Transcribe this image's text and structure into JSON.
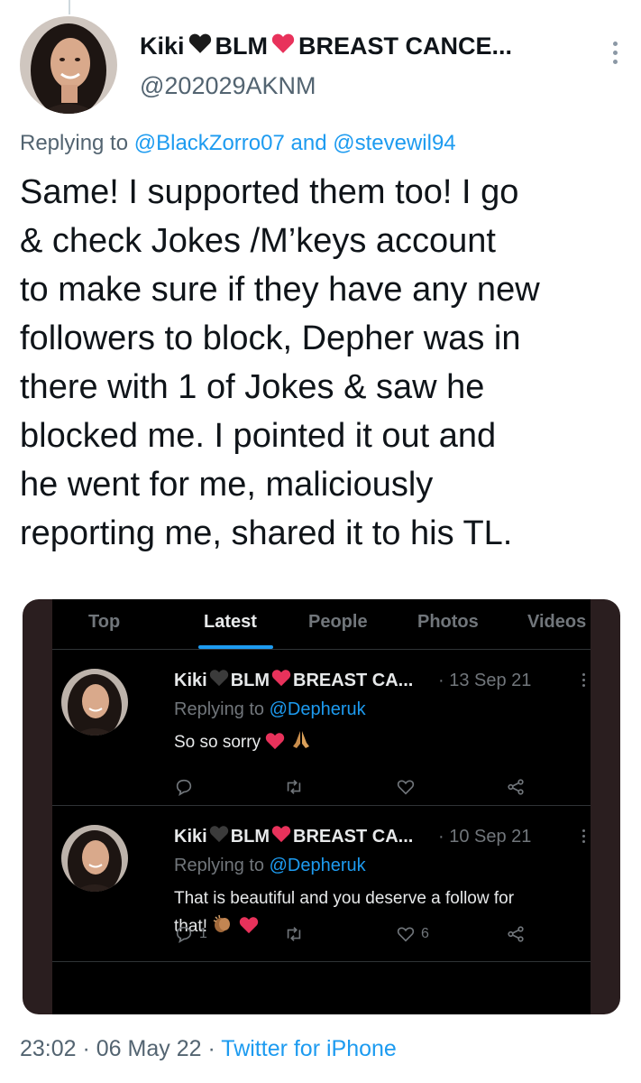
{
  "author": {
    "name_first": "Kiki",
    "name_blm": "BLM",
    "name_rest": "BREAST CANCE...",
    "handle": "@202029AKNM"
  },
  "reply": {
    "prefix": "Replying to",
    "user1": "@BlackZorro07",
    "conj": "and",
    "user2": "@stevewil94"
  },
  "tweet_lines": [
    "Same! I supported them too! I go",
    "& check Jokes /M’keys account",
    "to make sure if they have any new",
    "followers to block, Depher was in",
    "there with 1 of Jokes & saw he",
    "blocked me. I pointed it out and",
    "he went for me, maliciously",
    "reporting me, shared it to his TL."
  ],
  "embedded_screenshot": {
    "tabs": [
      "Top",
      "Latest",
      "People",
      "Photos",
      "Videos"
    ],
    "active_tab": "Latest",
    "tweets": [
      {
        "name_first": "Kiki",
        "name_blm": "BLM",
        "name_rest": "BREAST CA...",
        "date": "· 13 Sep 21",
        "reply_prefix": "Replying to",
        "reply_user": "@Depheruk",
        "body_line1": "So so sorry",
        "body_line2": "",
        "reply_count": "",
        "like_count": ""
      },
      {
        "name_first": "Kiki",
        "name_blm": "BLM",
        "name_rest": "BREAST CA...",
        "date": "· 10 Sep 21",
        "reply_prefix": "Replying to",
        "reply_user": "@Depheruk",
        "body_line1": "That is beautiful and you deserve a follow for",
        "body_line2": "that!",
        "reply_count": "1",
        "like_count": "6"
      }
    ]
  },
  "footer": {
    "time": "23:02",
    "sep1": " · ",
    "date": "06 May 22",
    "sep2": " · ",
    "source": "Twitter for iPhone"
  },
  "colors": {
    "link": "#1d9bf0",
    "secondary_text": "#536471",
    "heart_red": "#e8325b",
    "black_heart": "#1a1a1a",
    "embed_background": "#000000"
  },
  "icons": [
    "black-heart-icon",
    "red-heart-icon",
    "praying-hands-icon",
    "clapping-hands-icon",
    "reply-icon",
    "retweet-icon",
    "like-icon",
    "share-icon",
    "more-options-icon"
  ]
}
